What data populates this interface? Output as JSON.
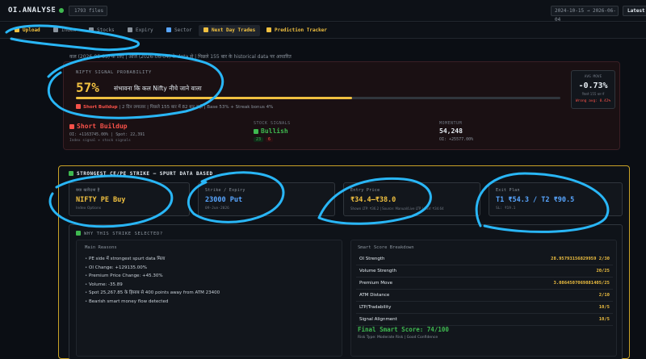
{
  "header": {
    "title": "OI.ANALYSE",
    "version": "v1",
    "files": "1793 files",
    "date_range": "2024-10-15 → 2026-06-04",
    "latest": "Latest"
  },
  "tabs": [
    {
      "label": "Upload",
      "color": "#f0c040"
    },
    {
      "label": "Index",
      "color": "#8b949e"
    },
    {
      "label": "Stocks",
      "color": "#8b949e"
    },
    {
      "label": "Expiry",
      "color": "#8b949e"
    },
    {
      "label": "Sector",
      "color": "#58a6ff"
    },
    {
      "label": "Next Day Trades",
      "color": "#f0c040"
    },
    {
      "label": "Prediction Tracker",
      "color": "#f0c040"
    }
  ],
  "signal": {
    "header": "कल (2026-06-05) के लिए | आज (2026-06-04) के data से | पिछले 155 बार के historical data पर आधारित",
    "label": "NIFTY SIGNAL PROBABILITY",
    "probability": "57%",
    "probability_value": 57,
    "text": "संभावना कि कल Nifty नीचे जाने वाला",
    "note_tag": "Short Buildup",
    "note": "| 2 दिन लगातार | पिछले 155 बार में 82 बार सही | Base 53% + Streak bonus 4%",
    "side_label": "AVG MOVE",
    "side_value": "-0.73%",
    "side_sub": "पिछले 155 बार में",
    "side_warn": "Wrong avg: 0.42%"
  },
  "stats": [
    {
      "label": "PRICE SIGNAL",
      "value": "Short Buildup",
      "color": "#f85149",
      "sub": "OI: +1163745.00% | Spot: 22,391",
      "sub2": "Index signal + stock signals"
    },
    {
      "label": "STOCK SIGNALS",
      "value": "Bullish",
      "color": "#3fb950",
      "bull": "23",
      "bear": "6"
    },
    {
      "label": "MOMENTUM",
      "value": "54,248",
      "color": "#e6edf3",
      "sub": "OI: +25577.00%"
    }
  ],
  "strike": {
    "title": "STRONGEST CE/PE STRIKE — SPURT DATA BASED",
    "boxes": [
      {
        "label": "क्या खरीदना है",
        "value": "NIFTY PE Buy",
        "color": "#f0c040",
        "sub": "Index Options"
      },
      {
        "label": "Strike / Expiry",
        "value": "23000 Put",
        "color": "#58a6ff",
        "sub": "09-Jun-2026"
      },
      {
        "label": "Entry Price",
        "value": "₹34.4–₹38.0",
        "color": "#f0c040",
        "sub": "Shown LTP: ₹36.2 | Source: Manual/Live LTP | CSV: ₹34.64"
      },
      {
        "label": "Exit Plan",
        "value": "T1 ₹54.3 / T2 ₹90.5",
        "color": "#58a6ff",
        "sub": "SL: ₹19.1"
      }
    ],
    "why_title": "WHY THIS STRIKE SELECTED?",
    "reasons_title": "Main Reasons",
    "reasons": [
      "PE side में strongest spurt data मिला",
      "OI Change: +129135.00%",
      "Premium Price Change: +45.30%",
      "Volume: -35.89",
      "Spot 25,267.85 के हिसाब से 400 points away from ATM 23400",
      "Bearish smart money flow detected"
    ],
    "score_title": "Smart Score Breakdown",
    "scores": [
      {
        "k": "OI Strength",
        "v": "28.95793156829959 2/30"
      },
      {
        "k": "Volume Strength",
        "v": "20/25"
      },
      {
        "k": "Premium Move",
        "v": "3.0864507069881405/25"
      },
      {
        "k": "ATM Distance",
        "v": "2/10"
      },
      {
        "k": "LTP/Tradability",
        "v": "10/5"
      },
      {
        "k": "Signal Alignment",
        "v": "10/5"
      }
    ],
    "final": "Final Smart Score: 74/100",
    "risk": "Risk Type: Moderate Risk | Good Confidence"
  }
}
